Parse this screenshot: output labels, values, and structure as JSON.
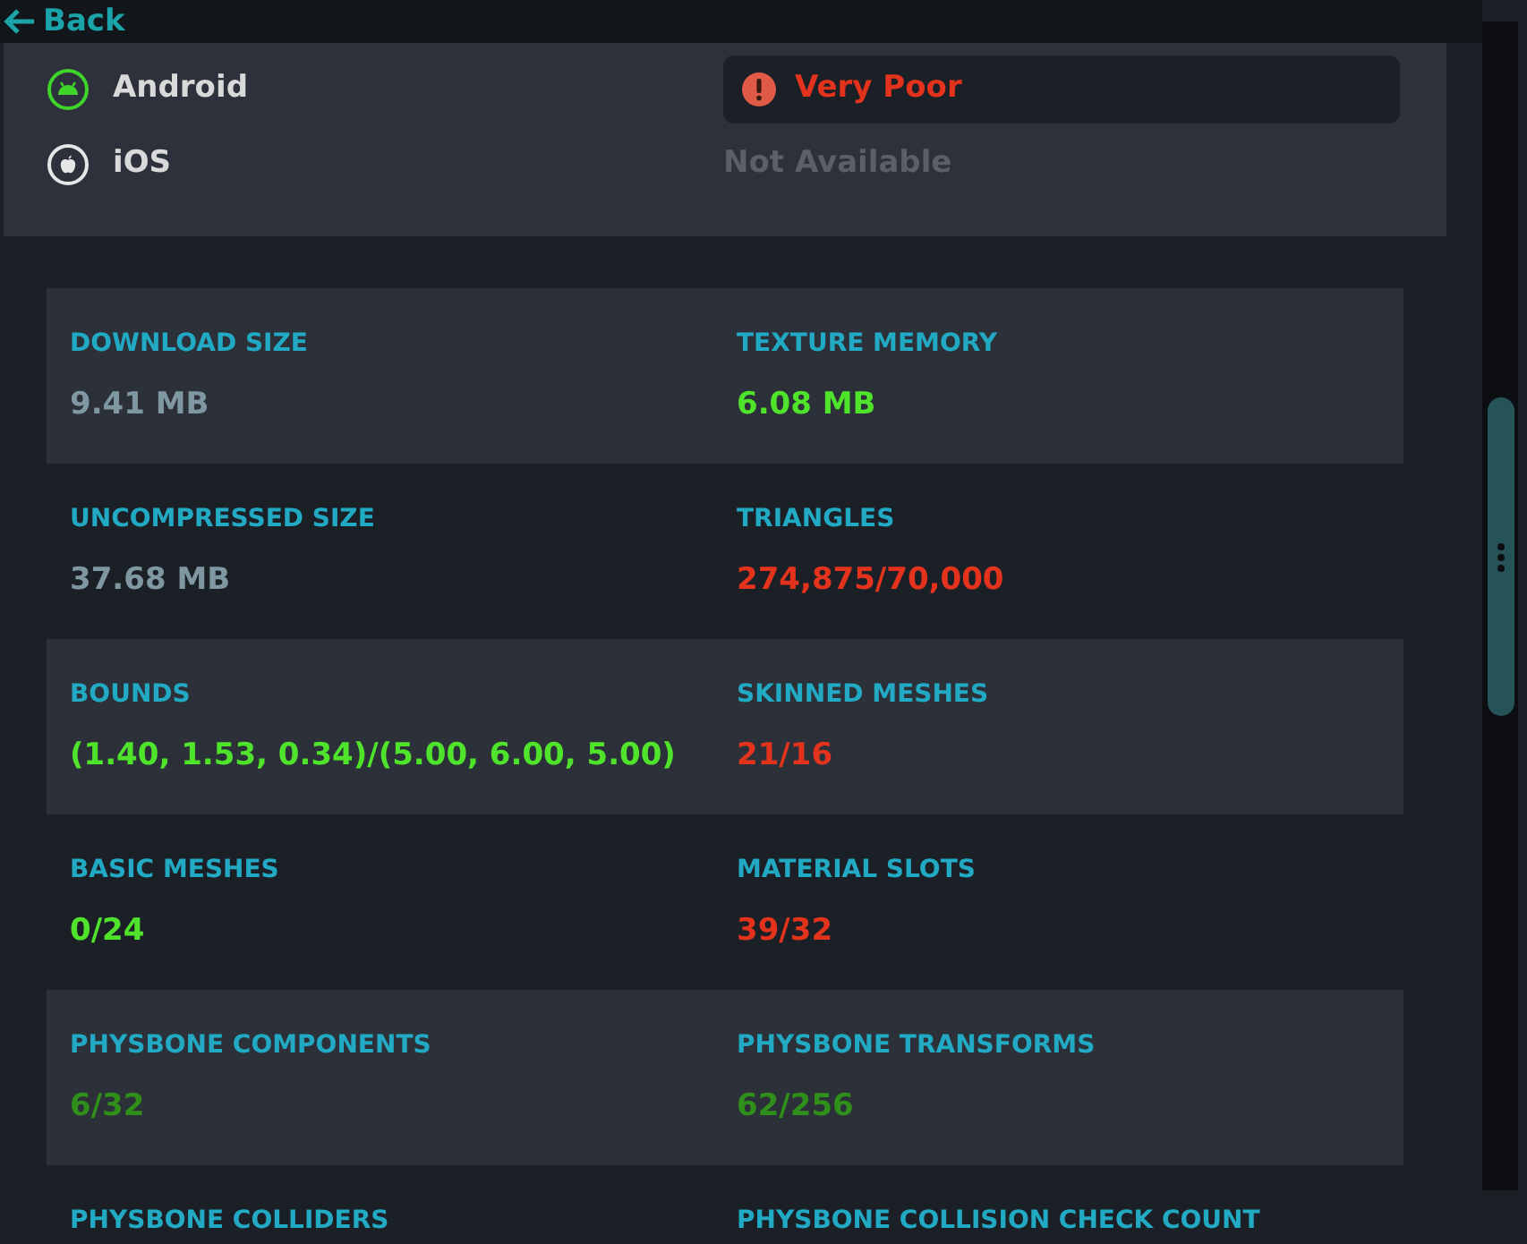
{
  "back": {
    "label": "Back"
  },
  "platforms": [
    {
      "name": "Android",
      "kind": "android",
      "status": "Very Poor",
      "available": true
    },
    {
      "name": "iOS",
      "kind": "apple",
      "status": "Not Available",
      "available": false
    }
  ],
  "stats": [
    {
      "label": "DOWNLOAD SIZE",
      "value": "9.41 MB",
      "color": "#7f97a0"
    },
    {
      "label": "TEXTURE MEMORY",
      "value": "6.08 MB",
      "color": "#4fe32b"
    },
    {
      "label": "UNCOMPRESSED SIZE",
      "value": "37.68 MB",
      "color": "#7f97a0"
    },
    {
      "label": "TRIANGLES",
      "value": "274,875/70,000",
      "color": "#e3331d"
    },
    {
      "label": "BOUNDS",
      "value": "(1.40, 1.53, 0.34)/(5.00, 6.00, 5.00)",
      "color": "#4fe32b"
    },
    {
      "label": "SKINNED MESHES",
      "value": "21/16",
      "color": "#e3331d"
    },
    {
      "label": "BASIC MESHES",
      "value": "0/24",
      "color": "#4fe32b"
    },
    {
      "label": "MATERIAL SLOTS",
      "value": "39/32",
      "color": "#e3331d"
    },
    {
      "label": "PHYSBONE COMPONENTS",
      "value": "6/32",
      "color": "#2f8f1a"
    },
    {
      "label": "PHYSBONE TRANSFORMS",
      "value": "62/256",
      "color": "#2f8f1a"
    },
    {
      "label": "PHYSBONE COLLIDERS"
    },
    {
      "label": "PHYSBONE COLLISION CHECK COUNT"
    }
  ]
}
